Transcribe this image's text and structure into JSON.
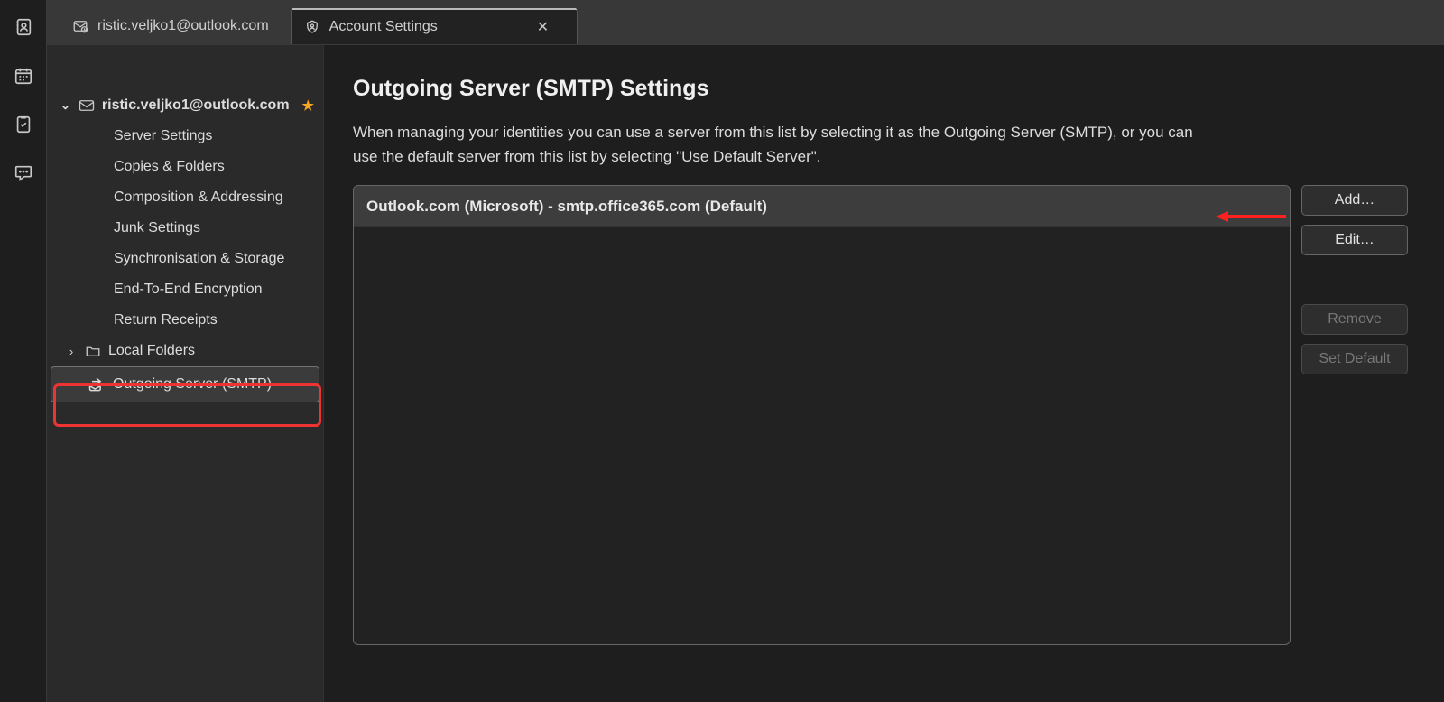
{
  "tabs": {
    "mail_tab_label": "ristic.veljko1@outlook.com",
    "settings_tab_label": "Account Settings"
  },
  "sidebar": {
    "account_email": "ristic.veljko1@outlook.com",
    "items": [
      "Server Settings",
      "Copies & Folders",
      "Composition & Addressing",
      "Junk Settings",
      "Synchronisation & Storage",
      "End-To-End Encryption",
      "Return Receipts"
    ],
    "local_folders_label": "Local Folders",
    "smtp_label": "Outgoing Server (SMTP)"
  },
  "main": {
    "title": "Outgoing Server (SMTP) Settings",
    "description": "When managing your identities you can use a server from this list by selecting it as the Outgoing Server (SMTP), or you can use the default server from this list by selecting \"Use Default Server\".",
    "server_row": "Outlook.com (Microsoft) - smtp.office365.com (Default)",
    "buttons": {
      "add": "Add…",
      "edit": "Edit…",
      "remove": "Remove",
      "set_default": "Set Default"
    }
  }
}
